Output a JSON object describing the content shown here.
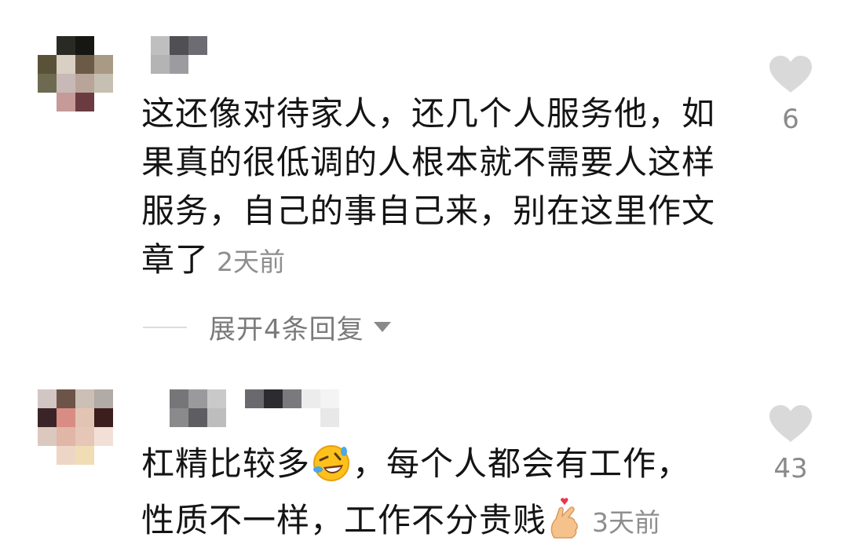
{
  "comments": [
    {
      "text": "这还像对待家人，还几个人服务他，如果真的很低调的人根本就不需要人这样服务，自己的事自己来，别在这里作文章了",
      "time": "2天前",
      "likes": "6",
      "replies_label": "展开4条回复"
    },
    {
      "text_part1": "杠精比较多",
      "text_part2": "，每个人都会有工作，性质不一样，工作不分贵贱",
      "time": "3天前",
      "likes": "43"
    }
  ],
  "icons": {
    "like": "heart-icon",
    "expand": "caret-down-icon",
    "emoji_1": "rolling-laughing-face-icon",
    "emoji_2": "finger-heart-icon"
  },
  "colors": {
    "text": "#141414",
    "muted": "#8e8e8e",
    "heart": "#d9d9d9"
  }
}
